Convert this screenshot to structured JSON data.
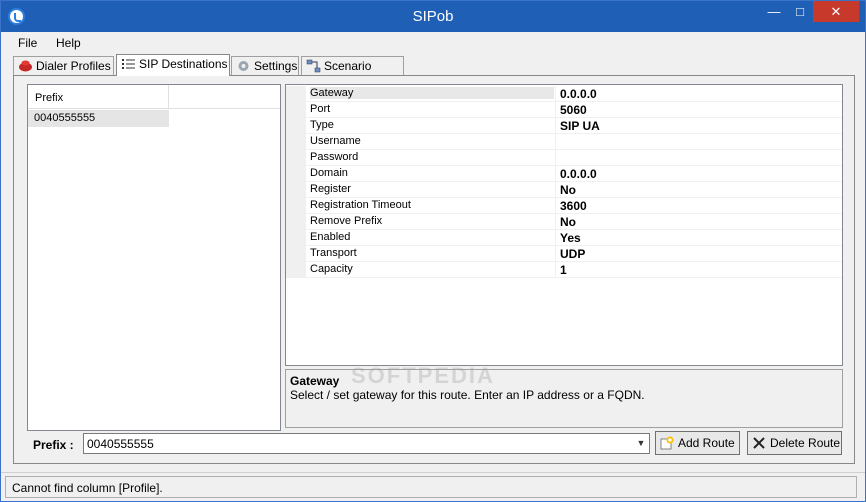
{
  "window": {
    "title": "SIPob"
  },
  "menu": {
    "items": [
      "File",
      "Help"
    ]
  },
  "tabs": [
    {
      "label": "Dialer Profiles",
      "icon": "phone-icon",
      "active": false
    },
    {
      "label": "SIP Destinations",
      "icon": "list-icon",
      "active": true
    },
    {
      "label": "Settings",
      "icon": "gear-icon",
      "active": false
    },
    {
      "label": "Scenario Editor",
      "icon": "diagram-icon",
      "active": false
    }
  ],
  "prefix_list": {
    "column_header": "Prefix",
    "rows": [
      "0040555555"
    ]
  },
  "properties": [
    {
      "name": "Gateway",
      "value": "0.0.0.0"
    },
    {
      "name": "Port",
      "value": "5060"
    },
    {
      "name": "Type",
      "value": "SIP UA"
    },
    {
      "name": "Username",
      "value": ""
    },
    {
      "name": "Password",
      "value": ""
    },
    {
      "name": "Domain",
      "value": "0.0.0.0"
    },
    {
      "name": "Register",
      "value": "No"
    },
    {
      "name": "Registration Timeout",
      "value": "3600"
    },
    {
      "name": "Remove Prefix",
      "value": "No"
    },
    {
      "name": "Enabled",
      "value": "Yes"
    },
    {
      "name": "Transport",
      "value": "UDP"
    },
    {
      "name": "Capacity",
      "value": "1"
    }
  ],
  "help": {
    "title": "Gateway",
    "description": "Select / set gateway for this route. Enter an IP address or a FQDN."
  },
  "prefix_input": {
    "label": "Prefix :",
    "value": "0040555555"
  },
  "buttons": {
    "add_route": "Add Route",
    "delete_route": "Delete Route"
  },
  "status": {
    "text": "Cannot find column [Profile]."
  },
  "watermark": "SOFTPEDIA",
  "colors": {
    "titlebar": "#1f5fb5",
    "close_button": "#c7392b",
    "window_bg": "#f0f0f0"
  }
}
